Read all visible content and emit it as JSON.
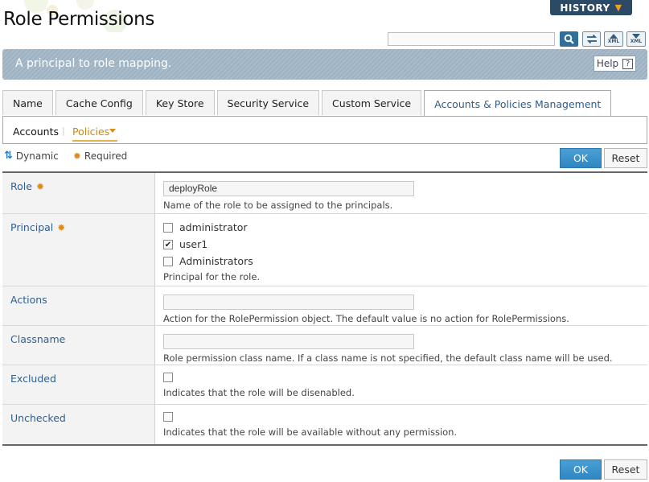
{
  "header": {
    "title": "Role Permissions",
    "history_label": "HISTORY",
    "search": {
      "value": "",
      "placeholder": ""
    },
    "tools": [
      "search-icon",
      "swap-icon",
      "xml-export-icon",
      "xml-import-icon"
    ],
    "xml_text": "XML"
  },
  "banner": {
    "text": "A principal to role mapping.",
    "help_label": "Help",
    "help_q": "?"
  },
  "tabs": [
    {
      "label": "Name"
    },
    {
      "label": "Cache Config"
    },
    {
      "label": "Key Store"
    },
    {
      "label": "Security Service"
    },
    {
      "label": "Custom Service"
    },
    {
      "label": "Accounts & Policies Management",
      "active": true
    }
  ],
  "subnav": {
    "accounts": "Accounts",
    "separator": "|",
    "policies": "Policies"
  },
  "legend": {
    "dynamic": "Dynamic",
    "required": "Required"
  },
  "buttons": {
    "ok": "OK",
    "reset": "Reset"
  },
  "form": {
    "role": {
      "label": "Role",
      "value": "deployRole",
      "desc": "Name of the role to be assigned to the principals."
    },
    "principal": {
      "label": "Principal",
      "options": [
        {
          "label": "administrator",
          "checked": false
        },
        {
          "label": "user1",
          "checked": true
        },
        {
          "label": "Administrators",
          "checked": false
        }
      ],
      "desc": "Principal for the role."
    },
    "actions": {
      "label": "Actions",
      "value": "",
      "desc": "Action for the RolePermission object. The default value is no action for RolePermissions."
    },
    "classname": {
      "label": "Classname",
      "value": "",
      "desc": "Role permission class name. If a class name is not specified, the default class name will be used."
    },
    "excluded": {
      "label": "Excluded",
      "checked": false,
      "desc": "Indicates that the role will be disenabled."
    },
    "unchecked": {
      "label": "Unchecked",
      "checked": false,
      "desc": "Indicates that the role will be available without any permission."
    }
  },
  "colors": {
    "accent": "#2f87c2",
    "required": "#e08a1a",
    "label": "#2f5f8f",
    "banner": "#a4b7c6"
  }
}
